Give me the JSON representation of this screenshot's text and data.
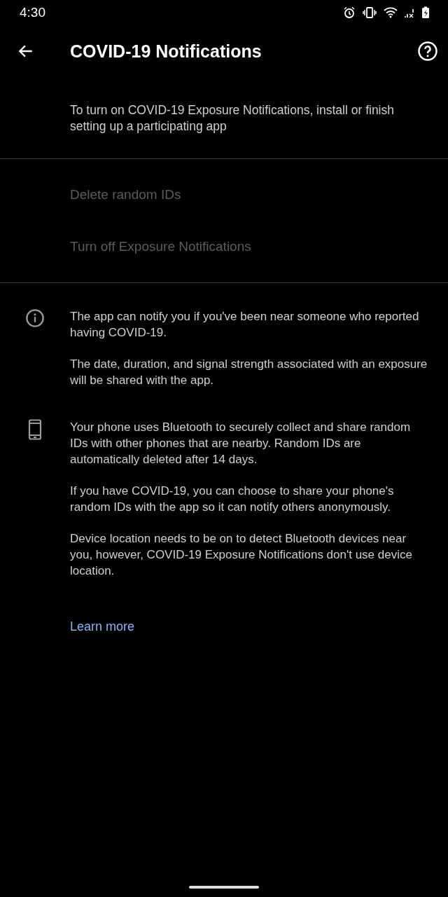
{
  "status_bar": {
    "time": "4:30"
  },
  "app_bar": {
    "title": "COVID-19 Notifications"
  },
  "summary": "To turn on COVID-19 Exposure Notifications, install or finish setting up a participating app",
  "actions": [
    {
      "label": "Delete random IDs",
      "disabled": true
    },
    {
      "label": "Turn off Exposure Notifications",
      "disabled": true
    }
  ],
  "info_sections": [
    {
      "kind": "info",
      "paragraphs": [
        "The app can notify you if you've been near someone who reported having COVID-19.",
        "The date, duration, and signal strength associated with an exposure will be shared with the app."
      ]
    },
    {
      "kind": "phone",
      "paragraphs": [
        "Your phone uses Bluetooth to securely collect and share random IDs with other phones that are nearby. Random IDs are automatically deleted after 14 days.",
        "If you have COVID-19, you can choose to share your phone's random IDs with the app so it can notify others anonymously.",
        "Device location needs to be on to detect Bluetooth devices near you, however, COVID-19 Exposure Notifications don't use device location."
      ]
    }
  ],
  "learn_more": "Learn more"
}
